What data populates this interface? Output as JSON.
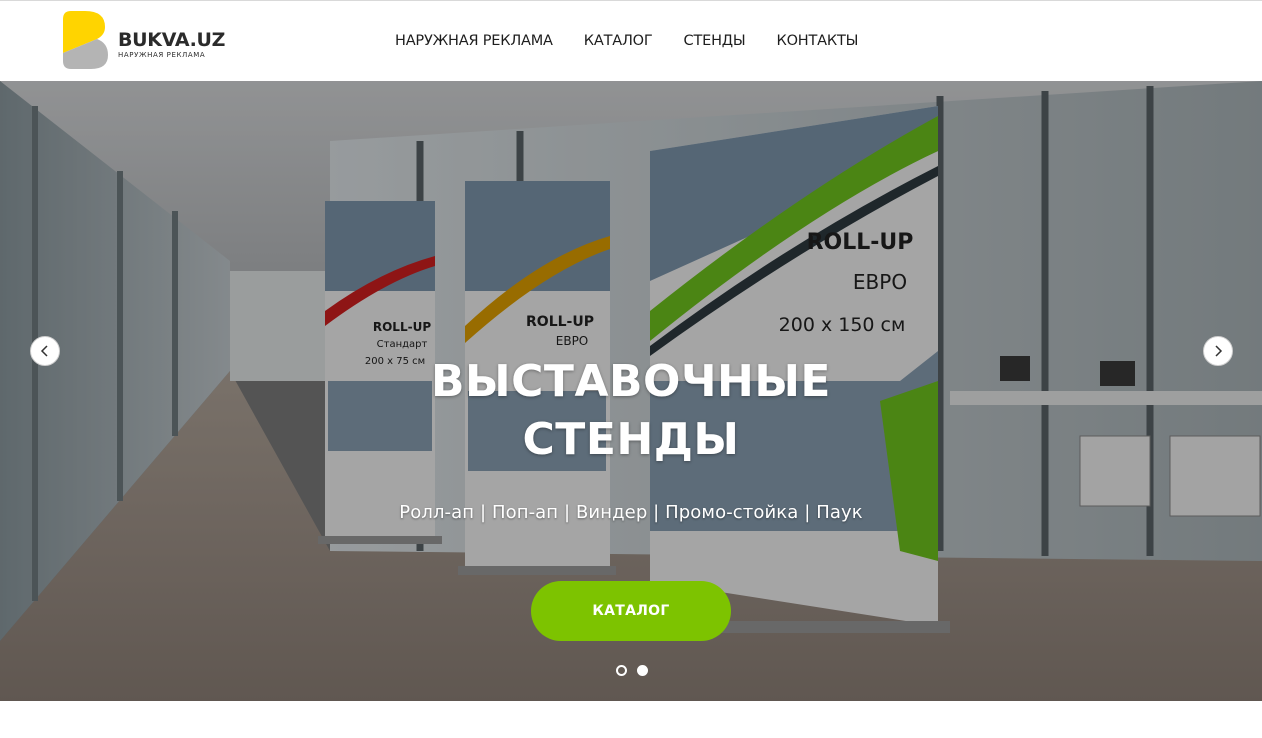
{
  "brand": {
    "name": "BUKVA.UZ",
    "tagline": "НАРУЖНАЯ РЕКЛАМА",
    "colors": {
      "yellow": "#ffd400",
      "gray": "#b4b4b4",
      "accent": "#7dc300"
    }
  },
  "nav": {
    "items": [
      {
        "label": "НАРУЖНАЯ РЕКЛАМА"
      },
      {
        "label": "КАТАЛОГ"
      },
      {
        "label": "СТЕНДЫ"
      },
      {
        "label": "КОНТАКТЫ"
      }
    ]
  },
  "hero": {
    "title_line1": "ВЫСТАВОЧНЫЕ",
    "title_line2": "СТЕНДЫ",
    "subtitle": "Ролл-ап | Поп-ап | Виндер | Промо-стойка | Паук",
    "button_label": "КАТАЛОГ",
    "prev_icon": "chevron-left-icon",
    "next_icon": "chevron-right-icon",
    "slides_total": 2,
    "active_slide": 2,
    "banners": [
      {
        "title": "ROLL-UP",
        "line2": "Стандарт",
        "line3": "200 х 75 см",
        "accent": "#d21f1f"
      },
      {
        "title": "ROLL-UP",
        "line2": "ЕВРО",
        "line3": "",
        "accent": "#e0a000"
      },
      {
        "title": "ROLL-UP",
        "line2": "ЕВРО",
        "line3": "200 х 150 см",
        "accent": "#6fc51e"
      }
    ]
  }
}
